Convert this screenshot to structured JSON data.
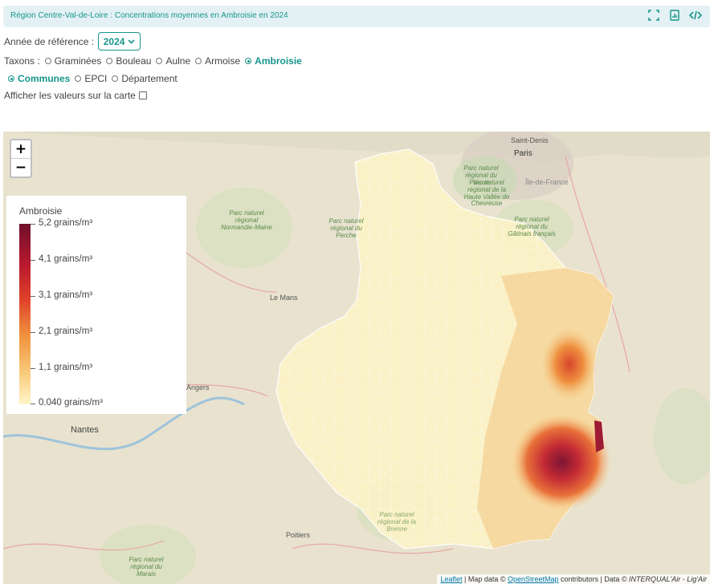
{
  "header": {
    "title": "Région Centre-Val-de-Loire : Concentrations moyennes en Ambroisie en 2024"
  },
  "controls": {
    "year_label": "Année de référence :",
    "year_value": "2024",
    "taxons_label": "Taxons :",
    "taxons": [
      "Graminées",
      "Bouleau",
      "Aulne",
      "Armoise",
      "Ambroisie"
    ],
    "selected_taxon": "Ambroisie",
    "levels": [
      "Communes",
      "EPCI",
      "Département"
    ],
    "selected_level": "Communes",
    "show_values_label": "Afficher les valeurs sur la carte"
  },
  "map": {
    "zoom_in": "+",
    "zoom_out": "−",
    "places": {
      "paris": "Paris",
      "saint_denis": "Saint-Denis",
      "le_mans": "Le Mans",
      "angers": "Angers",
      "nantes": "Nantes",
      "poitiers": "Poitiers"
    },
    "parks": {
      "normandie_maine": "Parc naturel régional Normandie-Maine",
      "perche": "Parc naturel régional du Perche",
      "vexin": "Parc naturel régional du Vexin",
      "chevreuse": "Parc naturel régional de la Haute Vallée de Chevreuse",
      "gatinais": "Parc naturel régional du Gâtinais français",
      "brenne": "Parc naturel régional de la Brenne",
      "marais": "Parc naturel régional du Marais"
    },
    "region": "Île-de-France",
    "attribution": {
      "leaflet": "Leaflet",
      "sep1": " | Map data © ",
      "osm": "OpenStreetMap",
      "sep2": " contributors | Data ",
      "data": "© INTERQUAL'Air - Lig'Air"
    }
  },
  "legend": {
    "title": "Ambroisie",
    "labels": [
      "5,2 grains/m³",
      "4,1 grains/m³",
      "3,1 grains/m³",
      "2,1 grains/m³",
      "1,1 grains/m³",
      "0.040 grains/m³"
    ]
  },
  "colors": {
    "accent": "#16958c",
    "low": "#fff6c8",
    "high": "#6f0f2c"
  }
}
